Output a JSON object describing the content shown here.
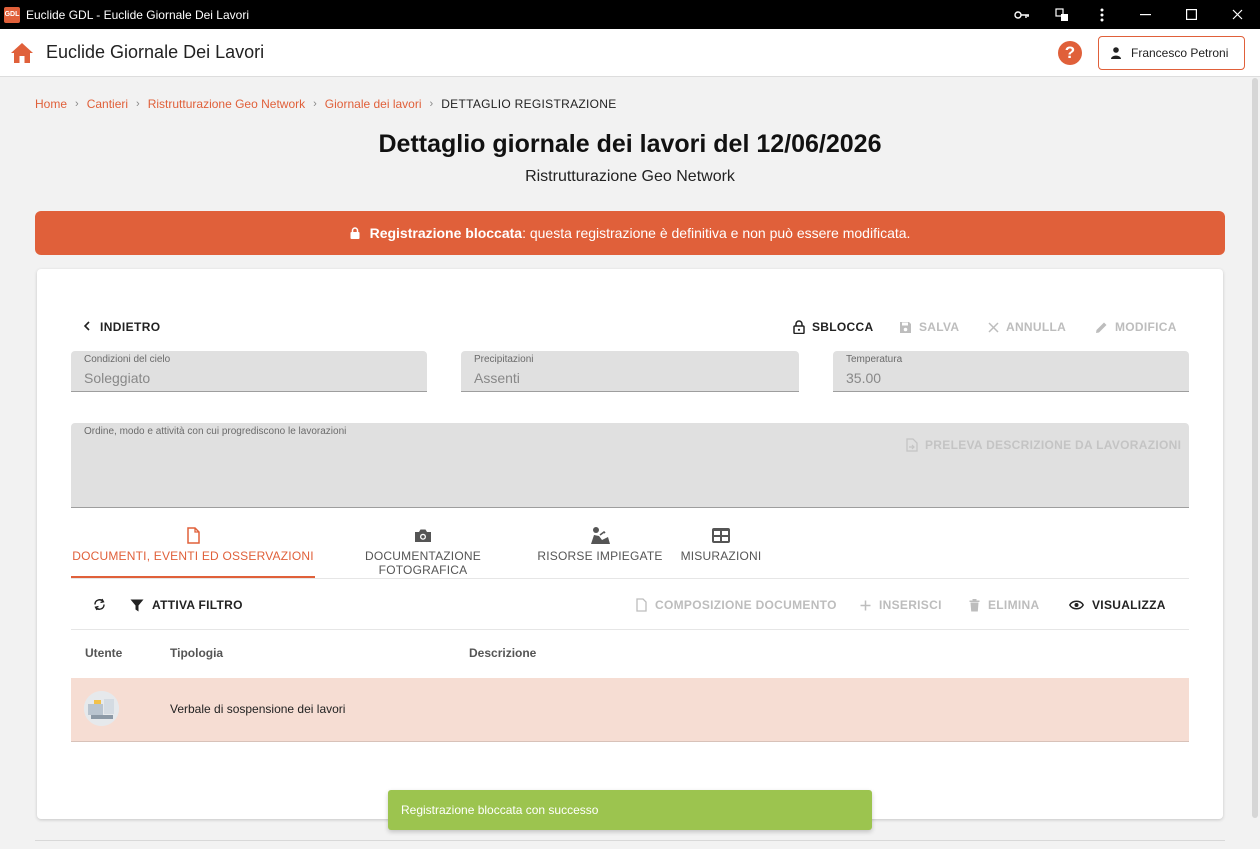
{
  "window": {
    "icon_text": "GDL",
    "title": "Euclide GDL - Euclide Giornale Dei Lavori"
  },
  "appbar": {
    "title": "Euclide Giornale Dei Lavori",
    "help_glyph": "?",
    "user_name": "Francesco Petroni"
  },
  "breadcrumb": {
    "items": [
      "Home",
      "Cantieri",
      "Ristrutturazione Geo Network",
      "Giornale dei lavori"
    ],
    "current": "DETTAGLIO REGISTRAZIONE"
  },
  "page": {
    "title": "Dettaglio giornale dei lavori del 12/06/2026",
    "subtitle": "Ristrutturazione Geo Network"
  },
  "banner": {
    "bold": "Registrazione bloccata",
    "text": ": questa registrazione è definitiva e non può essere modificata."
  },
  "actions": {
    "back": "INDIETRO",
    "unlock": "SBLOCCA",
    "save": "SALVA",
    "cancel": "ANNULLA",
    "edit": "MODIFICA"
  },
  "fields": {
    "sky": {
      "label": "Condizioni del cielo",
      "value": "Soleggiato"
    },
    "precipitation": {
      "label": "Precipitazioni",
      "value": "Assenti"
    },
    "temperature": {
      "label": "Temperatura",
      "value": "35.00"
    },
    "description": {
      "label": "Ordine, modo e attività con cui progrediscono le lavorazioni",
      "value": ""
    },
    "fetch_button": "PRELEVA DESCRIZIONE DA LAVORAZIONI"
  },
  "tabs": [
    {
      "label": "DOCUMENTI, EVENTI ED OSSERVAZIONI",
      "icon": "document-icon",
      "active": true
    },
    {
      "label": "DOCUMENTAZIONE FOTOGRAFICA",
      "icon": "camera-icon",
      "active": false
    },
    {
      "label": "RISORSE IMPIEGATE",
      "icon": "worker-icon",
      "active": false
    },
    {
      "label": "MISURAZIONI",
      "icon": "table-grid-icon",
      "active": false
    }
  ],
  "toolbar": {
    "filter": "ATTIVA FILTRO",
    "compose": "COMPOSIZIONE DOCUMENTO",
    "insert": "INSERISCI",
    "delete": "ELIMINA",
    "view": "VISUALIZZA"
  },
  "table": {
    "columns": [
      "Utente",
      "Tipologia",
      "Descrizione"
    ],
    "rows": [
      {
        "utente": "",
        "tipologia": "Verbale di sospensione dei lavori",
        "descrizione": ""
      }
    ]
  },
  "toast": "Registrazione bloccata con successo",
  "colors": {
    "accent": "#e0603a",
    "selected_row": "#f6ddd3",
    "toast": "#9cc44f"
  }
}
